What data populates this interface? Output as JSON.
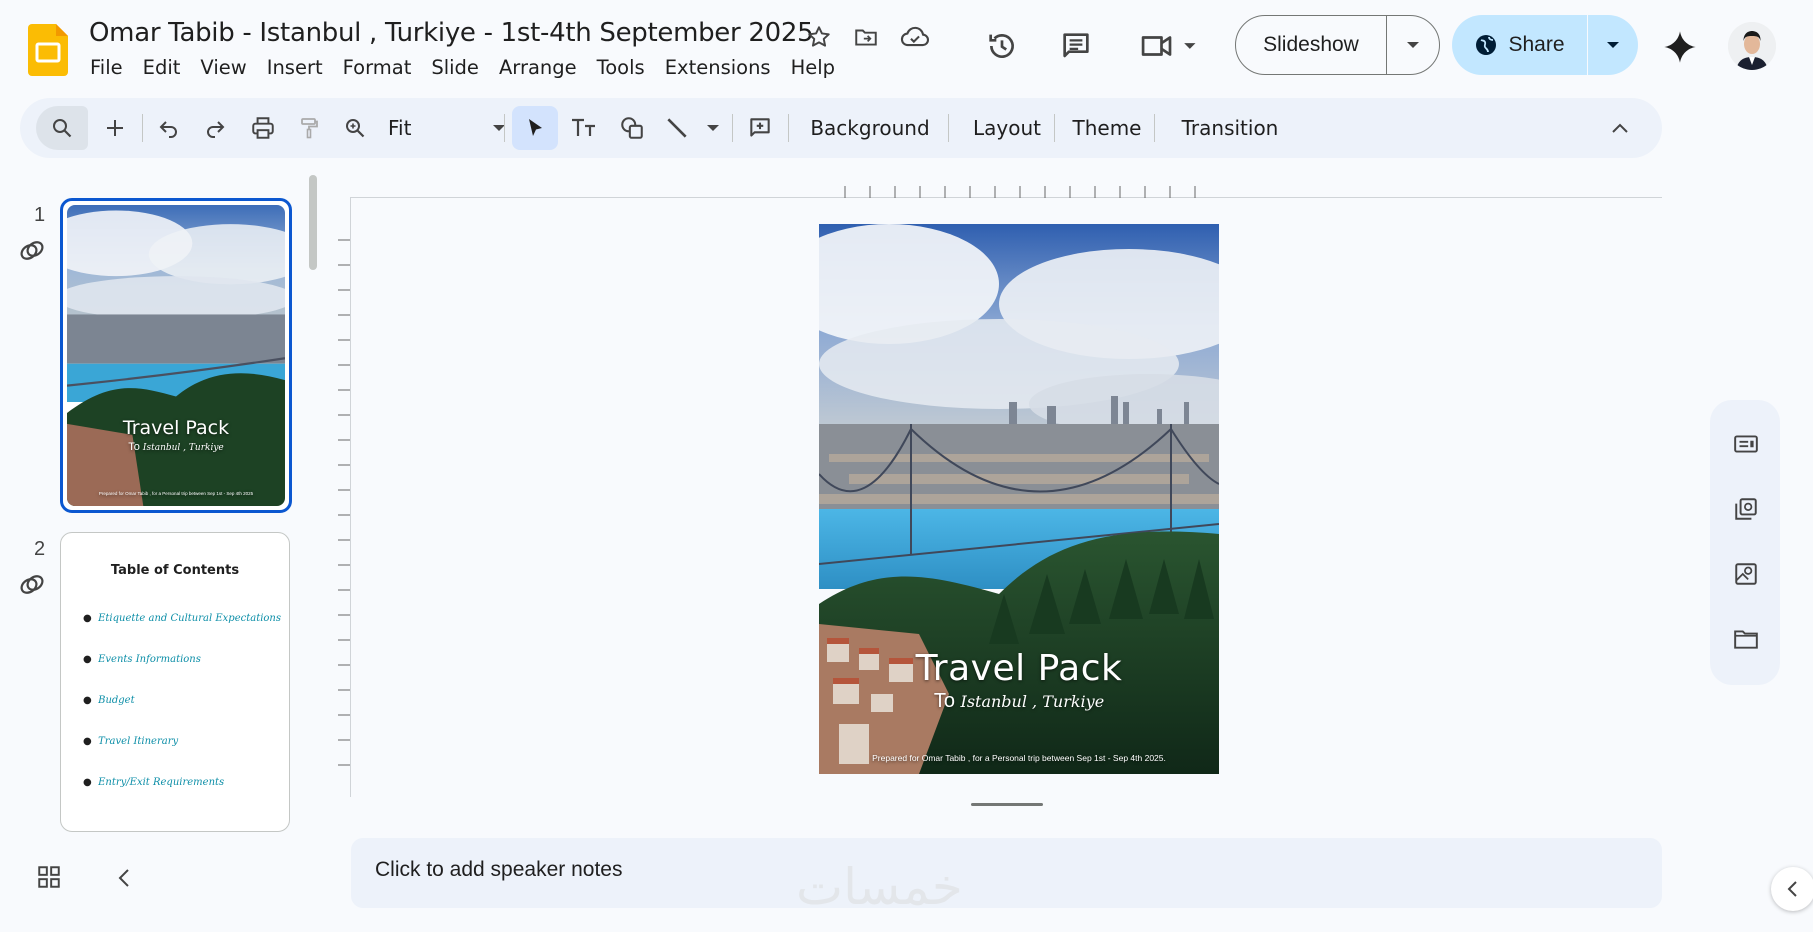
{
  "app": {
    "doc_title": "Omar Tabib - Istanbul , Turkiye - 1st-4th September 2025",
    "menu": [
      "File",
      "Edit",
      "View",
      "Insert",
      "Format",
      "Slide",
      "Arrange",
      "Tools",
      "Extensions",
      "Help"
    ]
  },
  "header": {
    "slideshow_label": "Slideshow",
    "share_label": "Share"
  },
  "toolbar": {
    "zoom_value": "Fit",
    "background_label": "Background",
    "layout_label": "Layout",
    "theme_label": "Theme",
    "transition_label": "Transition"
  },
  "filmstrip": {
    "slides": [
      {
        "number": "1",
        "title": "Travel Pack",
        "subtitle_prefix": "To",
        "subtitle_place": "Istanbul , Turkiye",
        "footer": "Prepared for Omar Tabib , for a Personal trip between Sep 1st - Sep 4th 2025"
      },
      {
        "number": "2",
        "title": "Table of Contents",
        "items": [
          "Etiquette and Cultural Expectations",
          "Events Informations",
          "Budget",
          "Travel Itinerary",
          "Entry/Exit Requirements"
        ]
      }
    ]
  },
  "slide": {
    "title": "Travel Pack",
    "subtitle_prefix": "To",
    "subtitle_place": "Istanbul , Turkiye",
    "footer": "Prepared for Omar Tabib , for a Personal trip between Sep 1st - Sep 4th 2025."
  },
  "notes": {
    "placeholder": "Click to add speaker notes"
  },
  "watermark": "خمسات",
  "colors": {
    "accent": "#0b57d0",
    "share_bg": "#c2e7ff",
    "toolbar_bg": "#edf2fa",
    "toc_link": "#0e8fa8",
    "logo_yellow": "#fbbc04"
  }
}
